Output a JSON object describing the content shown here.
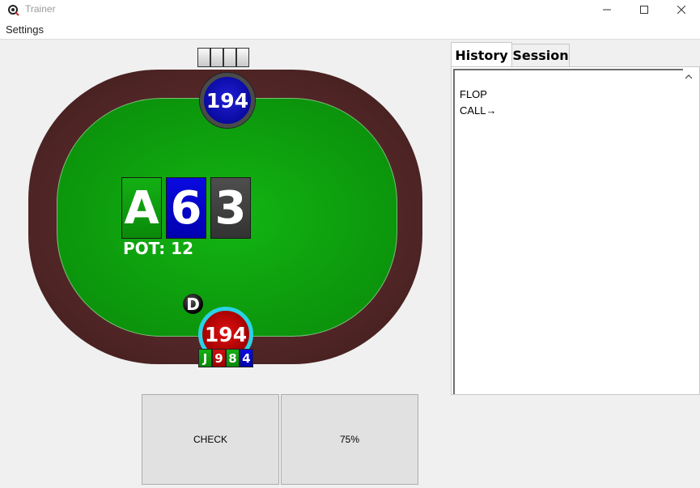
{
  "window": {
    "title": "Trainer"
  },
  "menu": {
    "settings": "Settings"
  },
  "table": {
    "opponent_stack": "194",
    "hero_stack": "194",
    "dealer_button": "D",
    "pot_label": "POT: 12",
    "board": [
      {
        "rank": "A",
        "suit": "clubs",
        "color": "#0fa80f"
      },
      {
        "rank": "6",
        "suit": "diamonds",
        "color": "#0000d0"
      },
      {
        "rank": "3",
        "suit": "spades",
        "color": "#444444"
      }
    ],
    "hero_hand": [
      {
        "rank": "J",
        "suit": "clubs",
        "color": "#0fa80f"
      },
      {
        "rank": "9",
        "suit": "hearts",
        "color": "#c00000"
      },
      {
        "rank": "8",
        "suit": "clubs",
        "color": "#0fa80f"
      },
      {
        "rank": "4",
        "suit": "diamonds",
        "color": "#0000d0"
      }
    ]
  },
  "panel": {
    "tabs": [
      "History",
      "Session"
    ],
    "active_tab": "History",
    "history_lines": [
      "FLOP",
      "CALL→"
    ]
  },
  "actions": {
    "check": "CHECK",
    "bet": "75%"
  }
}
